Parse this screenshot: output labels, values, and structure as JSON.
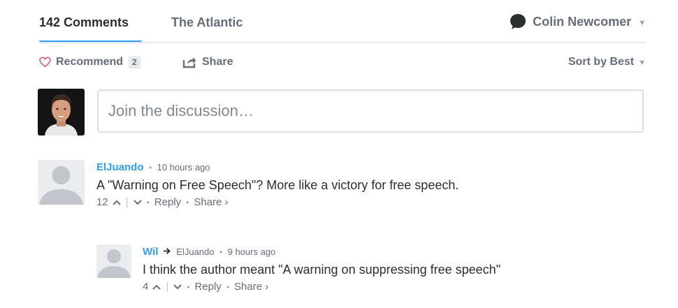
{
  "nav": {
    "comments_tab": "142 Comments",
    "site_tab": "The Atlantic",
    "user_name": "Colin Newcomer"
  },
  "actions": {
    "recommend_label": "Recommend",
    "recommend_count": "2",
    "share_label": "Share",
    "sort_label": "Sort by Best"
  },
  "composer": {
    "placeholder": "Join the discussion…"
  },
  "comments": [
    {
      "author": "ElJuando",
      "time": "10 hours ago",
      "text": "A \"Warning on Free Speech\"? More like a victory for free speech.",
      "upvotes": "12",
      "reply_label": "Reply",
      "share_label": "Share ›"
    },
    {
      "author": "Wil",
      "reply_to": "ElJuando",
      "time": "9 hours ago",
      "text": "I think the author meant \"A warning on suppressing free speech\"",
      "upvotes": "4",
      "reply_label": "Reply",
      "share_label": "Share ›"
    }
  ],
  "colors": {
    "accent": "#2e9fff",
    "text": "#2a2e2e",
    "muted": "#656c7a",
    "heart": "#e4405f"
  }
}
